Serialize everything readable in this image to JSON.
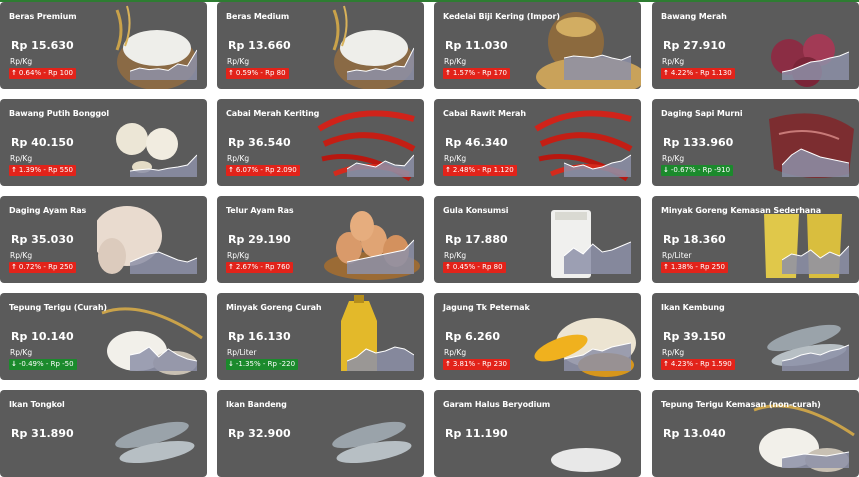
{
  "colors": {
    "card_bg": "#5b5b5b",
    "up": "#e2231a",
    "down": "#1b8a2c",
    "spark_fill": "#8d90a8",
    "spark_line": "#ffffff"
  },
  "commodities": [
    {
      "name": "Beras Premium",
      "price": "Rp 15.630",
      "unit": "Rp/Kg",
      "change": "0.64% - Rp 100",
      "direction": "up",
      "icon": "rice-icon",
      "trend": [
        0.22,
        0.3,
        0.26,
        0.28,
        0.24,
        0.4,
        0.35,
        0.75
      ]
    },
    {
      "name": "Beras Medium",
      "price": "Rp 13.660",
      "unit": "Rp/Kg",
      "change": "0.59% - Rp 80",
      "direction": "up",
      "icon": "rice-icon",
      "trend": [
        0.2,
        0.25,
        0.22,
        0.28,
        0.24,
        0.35,
        0.33,
        0.8
      ]
    },
    {
      "name": "Kedelai Biji Kering (Impor)",
      "price": "Rp 11.030",
      "unit": "Rp/Kg",
      "change": "1.57% - Rp 170",
      "direction": "up",
      "icon": "soybean-icon",
      "trend": [
        0.55,
        0.6,
        0.58,
        0.56,
        0.62,
        0.55,
        0.5,
        0.6
      ]
    },
    {
      "name": "Bawang Merah",
      "price": "Rp 27.910",
      "unit": "Rp/Kg",
      "change": "4.22% - Rp 1.130",
      "direction": "up",
      "icon": "shallot-icon",
      "trend": [
        0.2,
        0.25,
        0.35,
        0.45,
        0.48,
        0.55,
        0.6,
        0.7
      ]
    },
    {
      "name": "Bawang Putih Bonggol",
      "price": "Rp 40.150",
      "unit": "Rp/Kg",
      "change": "1.39% - Rp 550",
      "direction": "up",
      "icon": "garlic-icon",
      "trend": [
        0.15,
        0.18,
        0.2,
        0.17,
        0.22,
        0.25,
        0.3,
        0.55
      ]
    },
    {
      "name": "Cabai Merah Keriting",
      "price": "Rp 36.540",
      "unit": "Rp/Kg",
      "change": "6.07% - Rp 2.090",
      "direction": "up",
      "icon": "chili-icon",
      "trend": [
        0.2,
        0.35,
        0.3,
        0.25,
        0.4,
        0.3,
        0.28,
        0.55
      ]
    },
    {
      "name": "Cabai Rawit Merah",
      "price": "Rp 46.340",
      "unit": "Rp/Kg",
      "change": "2.48% - Rp 1.120",
      "direction": "up",
      "icon": "chili-icon",
      "trend": [
        0.35,
        0.25,
        0.3,
        0.2,
        0.25,
        0.35,
        0.4,
        0.55
      ]
    },
    {
      "name": "Daging Sapi Murni",
      "price": "Rp 133.960",
      "unit": "Rp/Kg",
      "change": "-0.67% - Rp -910",
      "direction": "down",
      "icon": "beef-icon",
      "trend": [
        0.3,
        0.55,
        0.7,
        0.6,
        0.5,
        0.45,
        0.4,
        0.35
      ]
    },
    {
      "name": "Daging Ayam Ras",
      "price": "Rp 35.030",
      "unit": "Rp/Kg",
      "change": "0.72% - Rp 250",
      "direction": "up",
      "icon": "chicken-icon",
      "trend": [
        0.3,
        0.4,
        0.5,
        0.55,
        0.45,
        0.35,
        0.3,
        0.4
      ]
    },
    {
      "name": "Telur Ayam Ras",
      "price": "Rp 29.190",
      "unit": "Rp/Kg",
      "change": "2.67% - Rp 760",
      "direction": "up",
      "icon": "egg-icon",
      "trend": [
        0.3,
        0.35,
        0.4,
        0.45,
        0.5,
        0.55,
        0.6,
        0.85
      ]
    },
    {
      "name": "Gula Konsumsi",
      "price": "Rp 17.880",
      "unit": "Rp/Kg",
      "change": "0.45% - Rp 80",
      "direction": "up",
      "icon": "sugar-icon",
      "trend": [
        0.45,
        0.65,
        0.5,
        0.75,
        0.55,
        0.6,
        0.7,
        0.8
      ]
    },
    {
      "name": "Minyak Goreng Kemasan Sederhana",
      "price": "Rp 18.360",
      "unit": "Rp/Liter",
      "change": "1.38% - Rp 250",
      "direction": "up",
      "icon": "oil-pouch-icon",
      "trend": [
        0.35,
        0.5,
        0.45,
        0.6,
        0.4,
        0.55,
        0.45,
        0.7
      ]
    },
    {
      "name": "Tepung Terigu (Curah)",
      "price": "Rp 10.140",
      "unit": "Rp/Kg",
      "change": "-0.49% - Rp -50",
      "direction": "down",
      "icon": "flour-icon",
      "trend": [
        0.4,
        0.45,
        0.6,
        0.35,
        0.55,
        0.4,
        0.3,
        0.25
      ]
    },
    {
      "name": "Minyak Goreng Curah",
      "price": "Rp 16.130",
      "unit": "Rp/Liter",
      "change": "-1.35% - Rp -220",
      "direction": "down",
      "icon": "oil-icon",
      "trend": [
        0.25,
        0.35,
        0.55,
        0.45,
        0.5,
        0.6,
        0.55,
        0.4
      ]
    },
    {
      "name": "Jagung Tk Peternak",
      "price": "Rp 6.260",
      "unit": "Rp/Kg",
      "change": "3.81% - Rp 230",
      "direction": "up",
      "icon": "corn-icon",
      "trend": [
        0.3,
        0.35,
        0.4,
        0.55,
        0.5,
        0.6,
        0.65,
        0.7
      ]
    },
    {
      "name": "Ikan Kembung",
      "price": "Rp 39.150",
      "unit": "Rp/Kg",
      "change": "4.23% - Rp 1.590",
      "direction": "up",
      "icon": "fish-icon",
      "trend": [
        0.25,
        0.3,
        0.4,
        0.45,
        0.4,
        0.5,
        0.55,
        0.65
      ]
    },
    {
      "name": "Ikan Tongkol",
      "price": "Rp 31.890",
      "unit": "",
      "change": "",
      "direction": "",
      "icon": "fish-icon",
      "trend": []
    },
    {
      "name": "Ikan Bandeng",
      "price": "Rp 32.900",
      "unit": "",
      "change": "",
      "direction": "",
      "icon": "fish-icon",
      "trend": []
    },
    {
      "name": "Garam Halus Beryodium",
      "price": "Rp 11.190",
      "unit": "",
      "change": "",
      "direction": "",
      "icon": "salt-icon",
      "trend": []
    },
    {
      "name": "Tepung Terigu Kemasan (non-curah)",
      "price": "Rp 13.040",
      "unit": "",
      "change": "",
      "direction": "",
      "icon": "flour-icon",
      "trend": [
        0.25,
        0.35,
        0.3,
        0.4
      ]
    }
  ]
}
